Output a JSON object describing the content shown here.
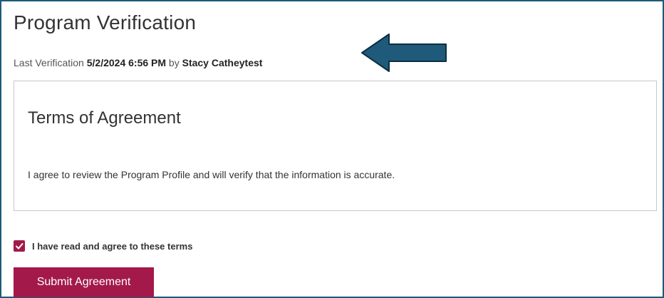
{
  "header": {
    "title": "Program Verification",
    "last_verification_label": "Last Verification",
    "last_verification_datetime": "5/2/2024 6:56 PM",
    "by_label": "by",
    "verified_by": "Stacy Catheytest"
  },
  "terms": {
    "title": "Terms of Agreement",
    "text": "I agree to review the Program Profile and will verify that the information is accurate."
  },
  "agreement": {
    "checkbox_label": "I have read and agree to these terms",
    "checked": true
  },
  "actions": {
    "submit_label": "Submit Agreement"
  },
  "colors": {
    "accent": "#a3194a",
    "arrow": "#1f5a7a",
    "border": "#c8c8c8"
  },
  "icons": {
    "annotation_arrow": "left-arrow-icon",
    "checkbox_mark": "checkmark-icon"
  }
}
